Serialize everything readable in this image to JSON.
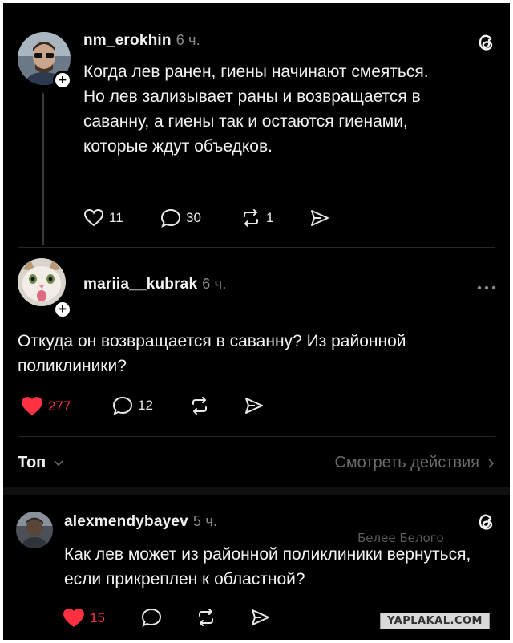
{
  "posts": [
    {
      "username": "nm_erokhin",
      "time": "6 ч.",
      "text": "Когда лев ранен, гиены начинают смеяться. Но лев зализывает раны и возвращается в саванну, а гиены так и остаются гиенами, которые ждут объедков.",
      "likes": "11",
      "comments": "30",
      "reposts": "1"
    },
    {
      "username": "mariia__kubrak",
      "time": "6 ч.",
      "text": "Откуда он возвращается в саванну? Из районной поликлиники?",
      "likes": "277",
      "comments": "12"
    },
    {
      "username": "alexmendybayev",
      "time": "5 ч.",
      "text": "Как лев может из районной поликлиники вернуться, если прикреплен к областной?",
      "likes": "15"
    }
  ],
  "sort_bar": {
    "label": "Топ",
    "activity_link": "Смотреть действия"
  },
  "watermarks": {
    "inline": "Белее Белого",
    "badge": "YAPLAKAL.COM"
  },
  "colors": {
    "background": "#000000",
    "text": "#f3f3f3",
    "muted": "#8a8a8a",
    "like_active": "#ff3040"
  },
  "icons": [
    "threads-icon",
    "heart-icon",
    "comment-icon",
    "repost-icon",
    "share-icon",
    "more-icon",
    "chevron-down-icon",
    "chevron-right-icon",
    "plus-icon"
  ]
}
